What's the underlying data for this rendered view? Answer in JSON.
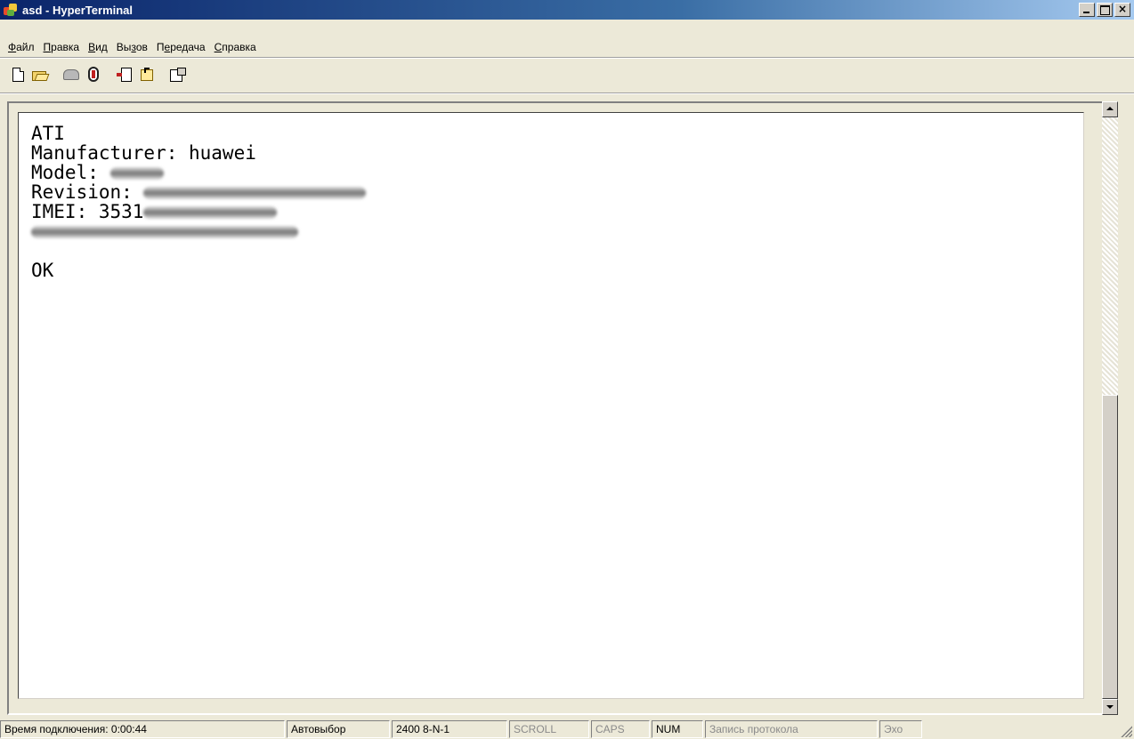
{
  "window": {
    "title": "asd - HyperTerminal"
  },
  "menu": [
    {
      "label": "Файл",
      "accel": "Ф",
      "rest": "айл"
    },
    {
      "label": "Правка",
      "accel": "П",
      "rest": "равка"
    },
    {
      "label": "Вид",
      "accel": "В",
      "rest": "ид"
    },
    {
      "label": "Вызов",
      "pre": "Вы",
      "accel": "з",
      "rest": "ов"
    },
    {
      "label": "Передача",
      "pre": "П",
      "accel": "е",
      "rest": "редача"
    },
    {
      "label": "Справка",
      "accel": "С",
      "rest": "правка"
    }
  ],
  "toolbar": {
    "icons": [
      "new-document-icon",
      "open-folder-icon",
      "dial-icon",
      "hang-up-icon",
      "send-file-icon",
      "receive-file-icon",
      "properties-icon"
    ]
  },
  "terminal": {
    "lines": {
      "l1": "ATI",
      "l2": "Manufacturer: huawei",
      "l3": "Model: ",
      "l4": "Revision: ",
      "l5": "IMEI: 3531",
      "l6": "",
      "l7": "",
      "l8": "OK"
    }
  },
  "status": {
    "connect_time": "Время подключения: 0:00:44",
    "detect": "Автовыбор",
    "port_settings": "2400 8-N-1",
    "scroll": "SCROLL",
    "caps": "CAPS",
    "num": "NUM",
    "capture": "Запись протокола",
    "echo": "Эхо"
  },
  "colors": {
    "titlebar_start": "#0a246a",
    "titlebar_end": "#a6caf0",
    "face": "#ece9d8",
    "terminal_bg": "#ffffff"
  }
}
